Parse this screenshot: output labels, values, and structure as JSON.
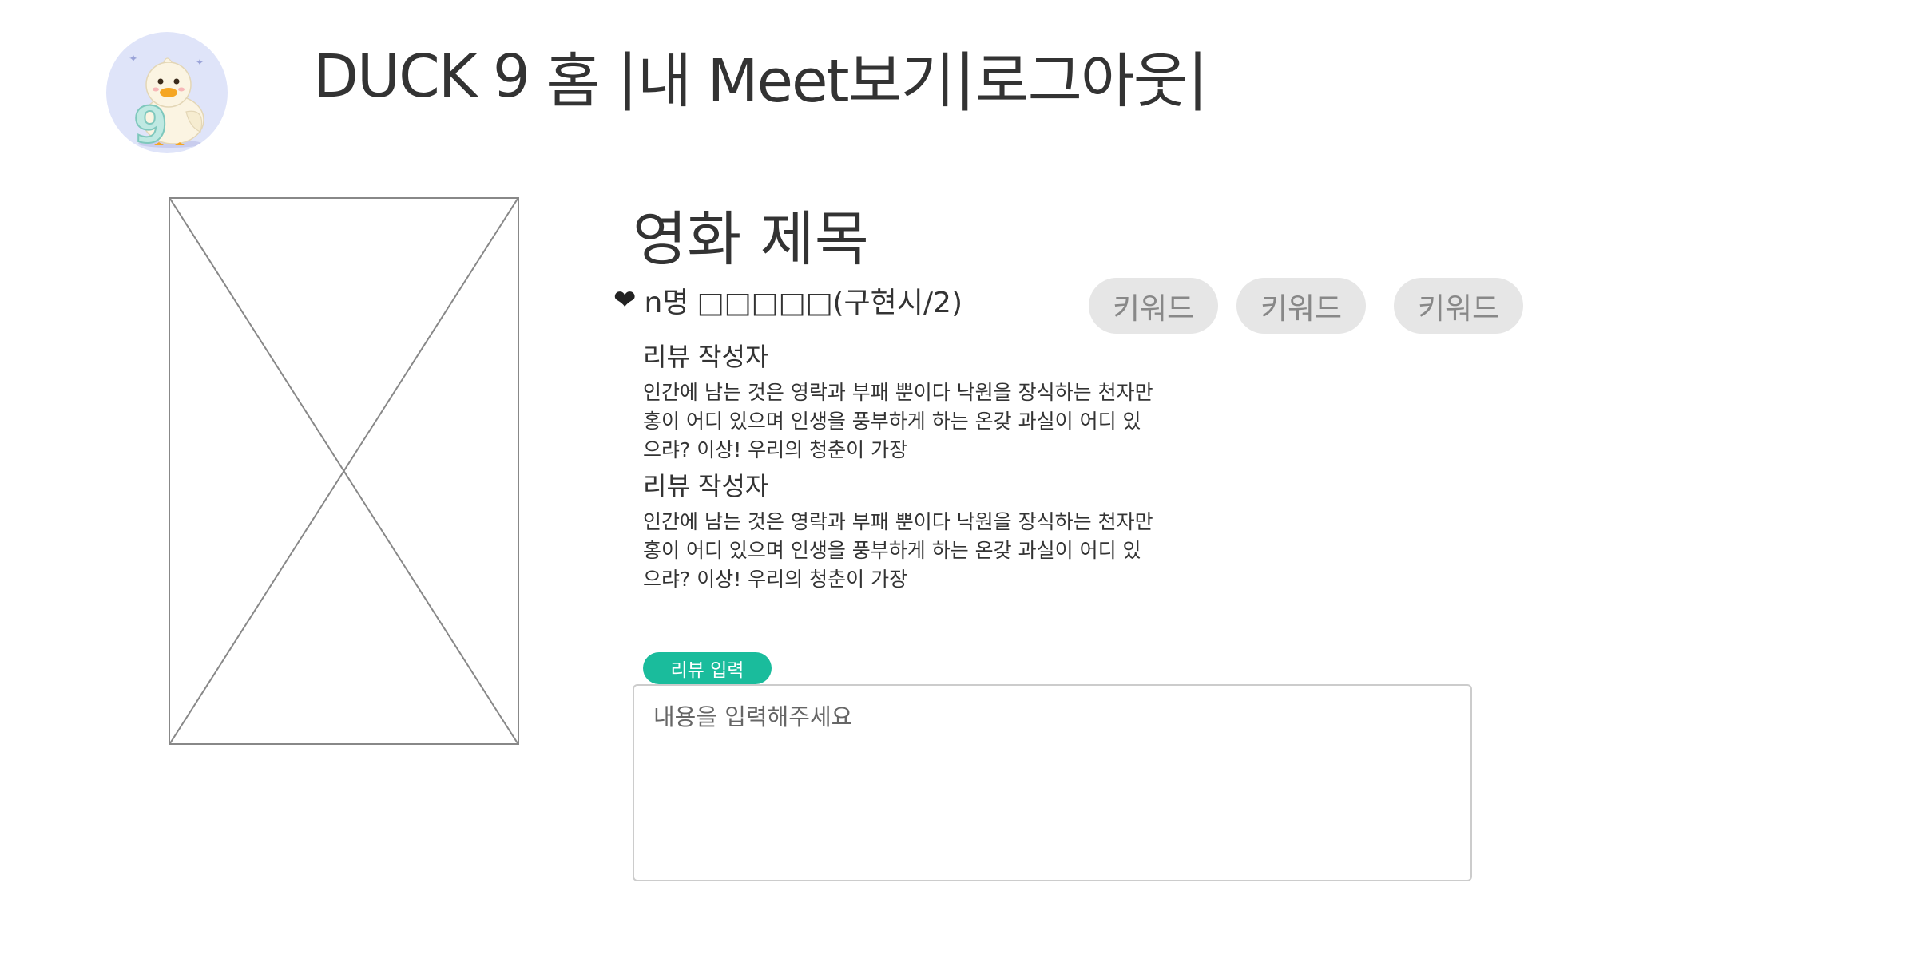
{
  "header": {
    "brand": "DUCK 9",
    "nav": {
      "home": "홈",
      "sep1": "|",
      "my_meet": "내 Meet보기",
      "sep2": "|",
      "logout": "로그아웃",
      "sep3": "|"
    },
    "logo_icon": "duck-9-logo"
  },
  "movie": {
    "title": "영화 제목",
    "heart_icon": "❤",
    "likes": "n명",
    "likes_placeholder": "□□□□□(구현시/2)",
    "keywords": [
      "키워드",
      "키워드",
      "키워드"
    ]
  },
  "reviews": [
    {
      "author": "리뷰 작성자",
      "body": "인간에 남는 것은 영락과 부패 뿐이다 낙원을 장식하는 천자만홍이 어디 있으며 인생을 풍부하게 하는 온갖 과실이 어디 있으랴? 이상! 우리의 청춘이 가장"
    },
    {
      "author": "리뷰 작성자",
      "body": "인간에 남는 것은 영락과 부패 뿐이다 낙원을 장식하는 천자만홍이 어디 있으며 인생을 풍부하게 하는 온갖 과실이 어디 있으랴? 이상! 우리의 청춘이 가장"
    }
  ],
  "review_input": {
    "label": "리뷰 입력",
    "placeholder": "내용을 입력해주세요",
    "value": ""
  },
  "colors": {
    "accent": "#1abc9c",
    "keyword_bg": "#e6e6e6",
    "logo_bg": "#dfe4f9"
  }
}
